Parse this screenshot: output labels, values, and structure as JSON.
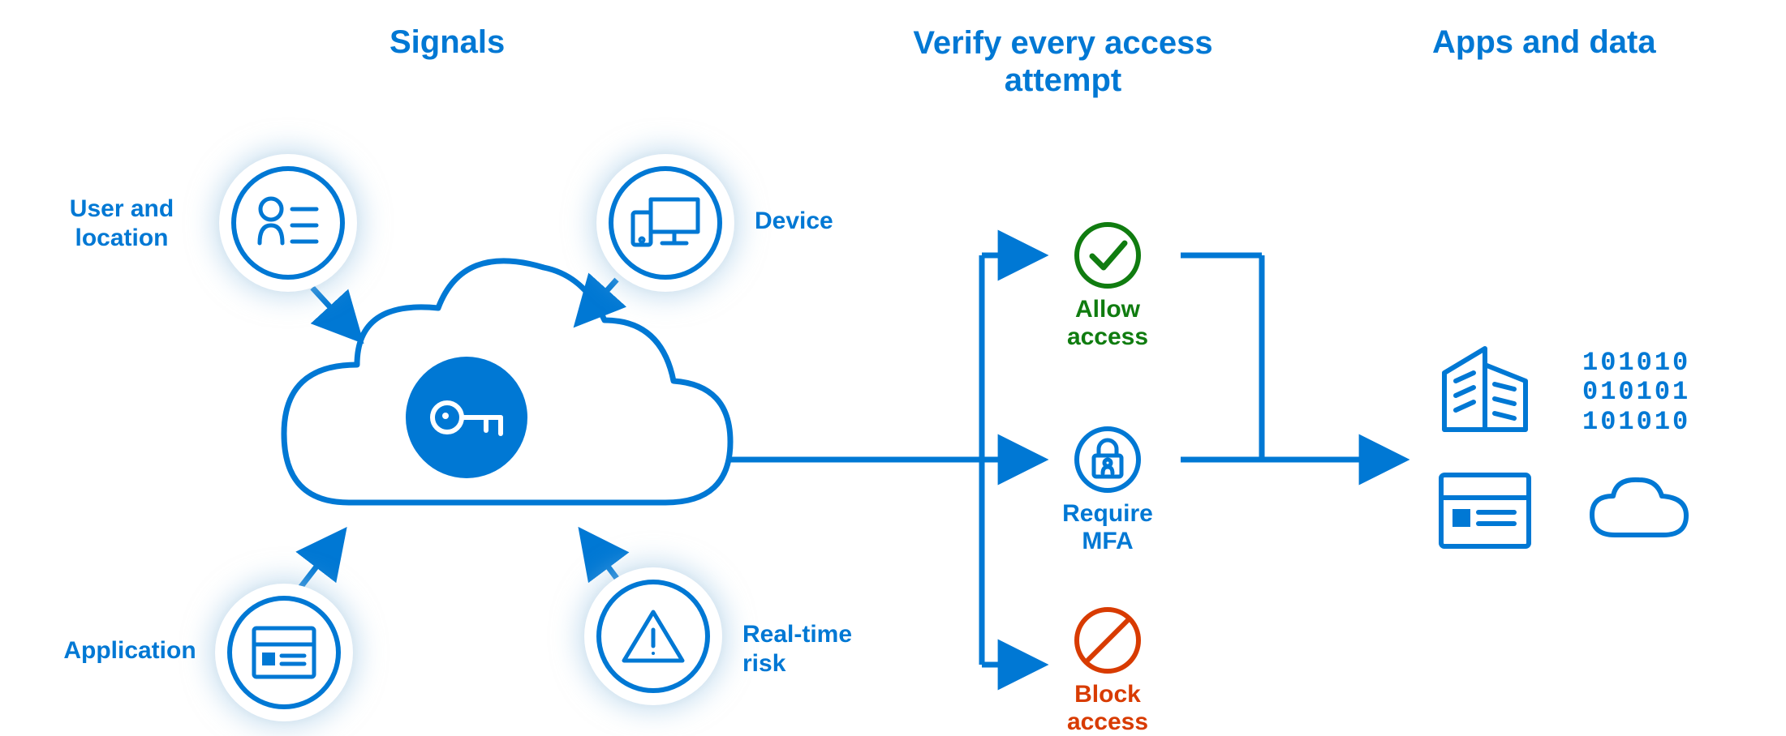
{
  "colors": {
    "primary": "#0078d4",
    "green": "#107c10",
    "orange": "#d83b01"
  },
  "headings": {
    "signals": "Signals",
    "verify": "Verify every access attempt",
    "apps": "Apps and data"
  },
  "signals": {
    "user_location": {
      "label": "User and\nlocation",
      "icon": "user-list-icon"
    },
    "device": {
      "label": "Device",
      "icon": "devices-icon"
    },
    "application": {
      "label": "Application",
      "icon": "app-window-icon"
    },
    "realtime_risk": {
      "label": "Real-time\nrisk",
      "icon": "warning-triangle-icon"
    }
  },
  "center": {
    "icon": "key-icon"
  },
  "outcomes": {
    "allow": {
      "label": "Allow access",
      "icon": "checkmark-circle-icon"
    },
    "mfa": {
      "label": "Require MFA",
      "icon": "lock-user-circle-icon"
    },
    "block": {
      "label": "Block access",
      "icon": "block-circle-icon"
    }
  },
  "apps_icons": [
    "buildings-icon",
    "binary-data-icon",
    "app-window-small-icon",
    "cloud-outline-icon"
  ],
  "binary_lines": [
    "101010",
    "010101",
    "101010"
  ]
}
